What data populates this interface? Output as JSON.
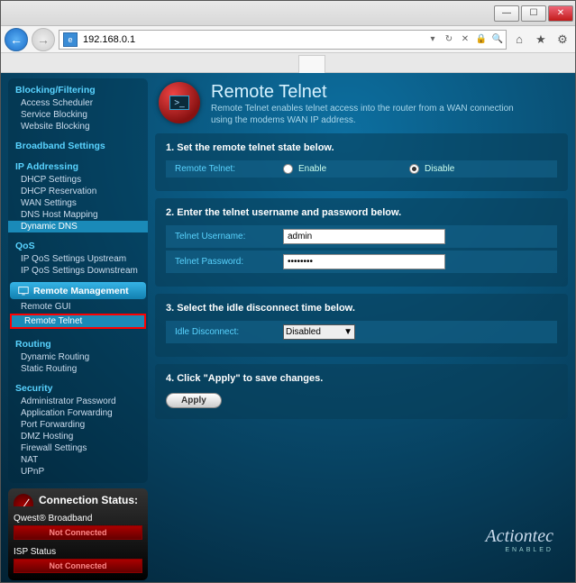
{
  "window": {
    "min": "—",
    "max": "☐",
    "close": "✕"
  },
  "address": {
    "url": "192.168.0.1",
    "lock": "🔒"
  },
  "toolbar_icons": {
    "home": "⌂",
    "star": "★",
    "gear": "⚙"
  },
  "sidebar": {
    "blocking": {
      "title": "Blocking/Filtering",
      "items": [
        "Access Scheduler",
        "Service Blocking",
        "Website Blocking"
      ]
    },
    "broadband": {
      "title": "Broadband Settings"
    },
    "ip": {
      "title": "IP Addressing",
      "items": [
        "DHCP Settings",
        "DHCP Reservation",
        "WAN Settings",
        "DNS Host Mapping",
        "Dynamic DNS"
      ]
    },
    "qos": {
      "title": "QoS",
      "items": [
        "IP QoS Settings Upstream",
        "IP QoS Settings Downstream"
      ]
    },
    "remote": {
      "title": "Remote Management",
      "items": [
        "Remote GUI",
        "Remote Telnet"
      ]
    },
    "routing": {
      "title": "Routing",
      "items": [
        "Dynamic Routing",
        "Static Routing"
      ]
    },
    "security": {
      "title": "Security",
      "items": [
        "Administrator Password",
        "Application Forwarding",
        "Port Forwarding",
        "DMZ Hosting",
        "Firewall Settings",
        "NAT",
        "UPnP"
      ]
    }
  },
  "status": {
    "title": "Connection Status:",
    "qwest_label": "Qwest® Broadband",
    "qwest_status": "Not Connected",
    "isp_label": "ISP Status",
    "isp_status": "Not Connected"
  },
  "page": {
    "title": "Remote Telnet",
    "subtitle": "Remote Telnet enables telnet access into the router from a WAN connection using the modems WAN IP address.",
    "sec1": {
      "head": "1. Set the remote telnet state below.",
      "label": "Remote Telnet:",
      "enable": "Enable",
      "disable": "Disable"
    },
    "sec2": {
      "head": "2. Enter the telnet username and password below.",
      "user_label": "Telnet Username:",
      "user_value": "admin",
      "pass_label": "Telnet Password:",
      "pass_value": "••••••••"
    },
    "sec3": {
      "head": "3. Select the idle disconnect time below.",
      "idle_label": "Idle Disconnect:",
      "idle_value": "Disabled"
    },
    "sec4": {
      "head": "4. Click \"Apply\" to save changes.",
      "apply": "Apply"
    }
  },
  "brand": {
    "name": "Actiontec",
    "sub": "ENABLED"
  }
}
